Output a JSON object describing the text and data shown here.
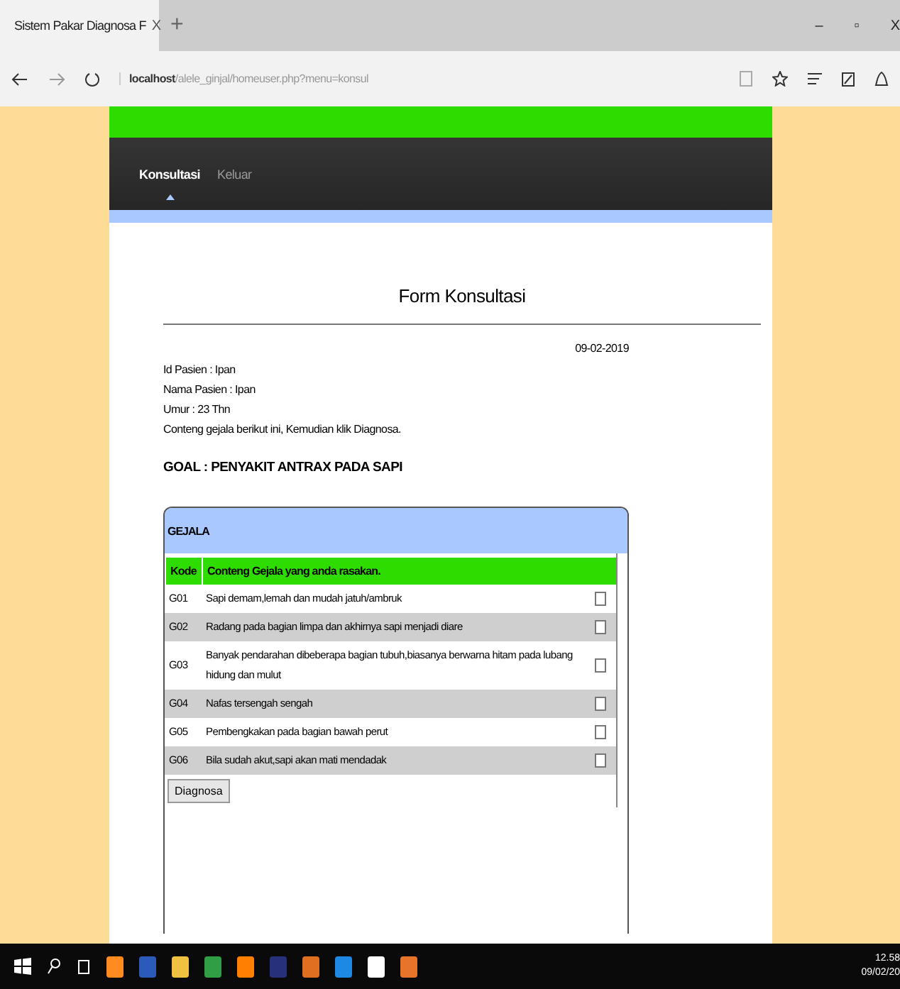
{
  "browser": {
    "tab_title": "Sistem Pakar Diagnosa F",
    "tab_close": "X",
    "new_tab": "+",
    "url_host": "localhost",
    "url_path": "/alele_ginjal/homeuser.php?menu=konsul",
    "window_buttons": [
      "–",
      "▫",
      "X"
    ]
  },
  "nav": {
    "items": [
      {
        "label": "Konsultasi",
        "selected": true
      },
      {
        "label": "Keluar",
        "selected": false
      }
    ]
  },
  "form": {
    "title": "Form Konsultasi",
    "date": "09-02-2019",
    "info": [
      "Id Pasien : Ipan",
      "Nama Pasien : Ipan",
      "Umur : 23 Thn",
      "Conteng gejala berikut ini, Kemudian klik Diagnosa."
    ],
    "goal": "GOAL : PENYAKIT ANTRAX PADA SAPI",
    "panel_title": "GEJALA",
    "columns": [
      "Kode",
      "Conteng Gejala yang anda rasakan."
    ],
    "rows": [
      {
        "code": "G01",
        "text": "Sapi demam,lemah dan mudah jatuh/ambruk",
        "checked": false
      },
      {
        "code": "G02",
        "text": "Radang pada bagian limpa dan akhirnya sapi menjadi diare",
        "checked": false
      },
      {
        "code": "G03",
        "text": "Banyak pendarahan dibeberapa bagian tubuh,biasanya berwarna hitam pada lubang hidung dan mulut",
        "checked": false
      },
      {
        "code": "G04",
        "text": "Nafas tersengah sengah",
        "checked": false
      },
      {
        "code": "G05",
        "text": "Pembengkakan pada bagian bawah perut",
        "checked": false
      },
      {
        "code": "G06",
        "text": "Bila sudah akut,sapi akan mati mendadak",
        "checked": false
      }
    ],
    "button": "Diagnosa"
  },
  "taskbar": {
    "time": "12.58",
    "date": "09/02/20"
  }
}
